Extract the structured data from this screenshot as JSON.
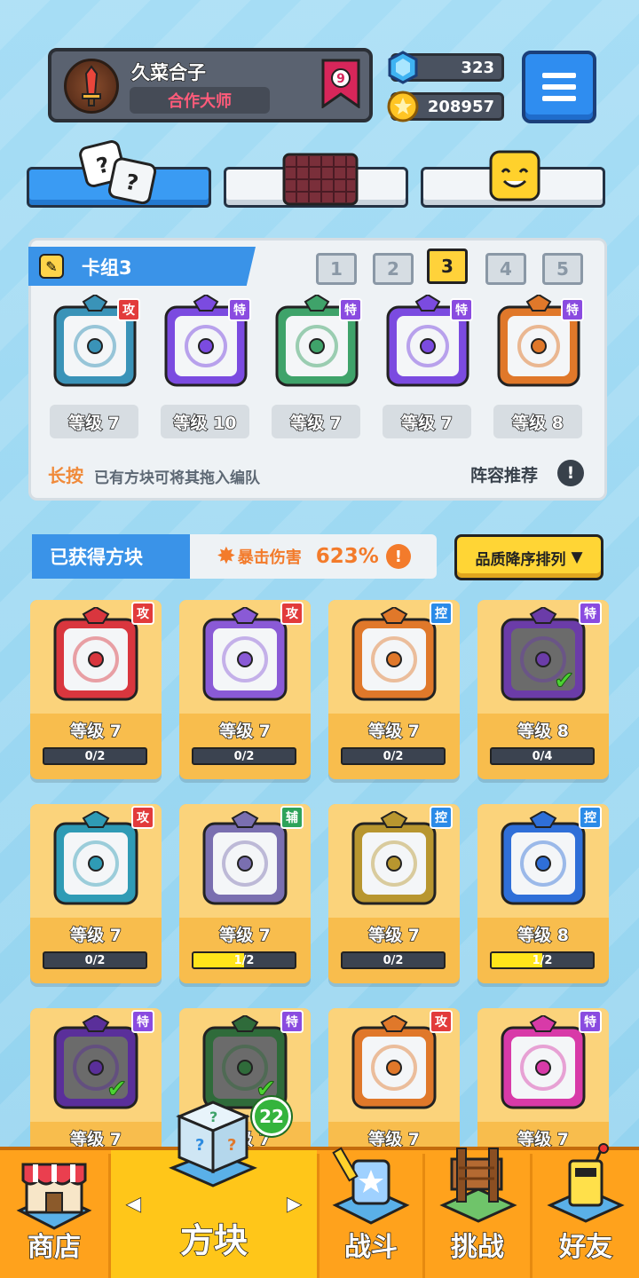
{
  "player": {
    "name": "久菜合子",
    "title": "合作大师",
    "rank": "9"
  },
  "currency": {
    "gems": "323",
    "coins": "208957"
  },
  "deck": {
    "label": "卡组3",
    "slots": [
      "1",
      "2",
      "3",
      "4",
      "5"
    ],
    "active_slot": 3,
    "cards": [
      {
        "tag": "攻",
        "level": "等级 7",
        "color": "#3a93b8"
      },
      {
        "tag": "特",
        "level": "等级 10",
        "color": "#7b4be0"
      },
      {
        "tag": "特",
        "level": "等级 7",
        "color": "#3fa36a"
      },
      {
        "tag": "特",
        "level": "等级 7",
        "color": "#7b4be0"
      },
      {
        "tag": "特",
        "level": "等级 8",
        "color": "#e0782a"
      }
    ],
    "hint_long": "长按",
    "hint_rest": "已有方块可将其拖入编队",
    "recommend": "阵容推荐",
    "recommend_icon": "!"
  },
  "obtained": {
    "label": "已获得方块",
    "crit_label": "暴击伤害",
    "crit_value": "623%",
    "info_icon": "!",
    "sort_label": "品质降序排列",
    "sort_arrow": "▼"
  },
  "blocks": [
    {
      "tag": "攻",
      "level": "等级 7",
      "progress": "0/2",
      "fill": 0,
      "color": "#d9363e",
      "tag_color": "#e23b3b",
      "check": false
    },
    {
      "tag": "攻",
      "level": "等级 7",
      "progress": "0/2",
      "fill": 0,
      "color": "#8a5ad6",
      "tag_color": "#e23b3b",
      "check": false
    },
    {
      "tag": "控",
      "level": "等级 7",
      "progress": "0/2",
      "fill": 0,
      "color": "#e0782a",
      "tag_color": "#2b8be8",
      "check": false
    },
    {
      "tag": "特",
      "level": "等级 8",
      "progress": "0/4",
      "fill": 0,
      "color": "#6b3ca8",
      "tag_color": "#8a4be0",
      "check": true
    },
    {
      "tag": "攻",
      "level": "等级 7",
      "progress": "0/2",
      "fill": 0,
      "color": "#2f9bb5",
      "tag_color": "#e23b3b",
      "check": false
    },
    {
      "tag": "辅",
      "level": "等级 7",
      "progress": "1/2",
      "fill": 0.5,
      "color": "#7a6fb0",
      "tag_color": "#2ea35a",
      "check": false
    },
    {
      "tag": "控",
      "level": "等级 7",
      "progress": "0/2",
      "fill": 0,
      "color": "#b8962f",
      "tag_color": "#2b8be8",
      "check": false
    },
    {
      "tag": "控",
      "level": "等级 8",
      "progress": "1/2",
      "fill": 0.5,
      "color": "#2f6fd8",
      "tag_color": "#2b8be8",
      "check": false
    },
    {
      "tag": "特",
      "level": "等级 7",
      "progress": "",
      "fill": 0,
      "color": "#5a2f9a",
      "tag_color": "#8a4be0",
      "check": true
    },
    {
      "tag": "特",
      "level": "等级 7",
      "progress": "",
      "fill": 0,
      "color": "#2f6b3a",
      "tag_color": "#8a4be0",
      "check": true
    },
    {
      "tag": "攻",
      "level": "等级 7",
      "progress": "",
      "fill": 0,
      "color": "#e0782a",
      "tag_color": "#e23b3b",
      "check": false
    },
    {
      "tag": "特",
      "level": "等级 7",
      "progress": "",
      "fill": 0,
      "color": "#d83aa8",
      "tag_color": "#8a4be0",
      "check": false
    }
  ],
  "nav": {
    "shop": "商店",
    "blocks": "方块",
    "battle": "战斗",
    "challenge": "挑战",
    "friends": "好友",
    "blocks_badge": "22",
    "arrow_left": "◀",
    "arrow_right": "▶"
  },
  "icons": {
    "gem": "gem-icon",
    "coin": "coin-icon",
    "menu": "menu-icon",
    "dice": "dice-icon",
    "grid": "grid-icon",
    "smile": "smile-icon",
    "pen": "pen-icon"
  }
}
